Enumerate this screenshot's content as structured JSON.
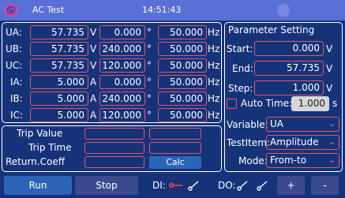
{
  "window": {
    "title": "AC Test",
    "time": "14:51:43"
  },
  "channels": [
    {
      "label": "UA:",
      "magnitude": "57.735",
      "mag_unit": "V",
      "angle": "0.000",
      "freq": "50.000"
    },
    {
      "label": "UB:",
      "magnitude": "57.735",
      "mag_unit": "V",
      "angle": "240.000",
      "freq": "50.000"
    },
    {
      "label": "UC:",
      "magnitude": "57.735",
      "mag_unit": "V",
      "angle": "120.000",
      "freq": "50.000"
    },
    {
      "label": "IA:",
      "magnitude": "5.000",
      "mag_unit": "A",
      "angle": "0.000",
      "freq": "50.000"
    },
    {
      "label": "IB:",
      "magnitude": "5.000",
      "mag_unit": "A",
      "angle": "240.000",
      "freq": "50.000"
    },
    {
      "label": "IC:",
      "magnitude": "5.000",
      "mag_unit": "A",
      "angle": "120.000",
      "freq": "50.000"
    }
  ],
  "units": {
    "angle": "°",
    "freq": "Hz"
  },
  "results": {
    "trip_value_label": "Trip Value",
    "trip_time_label": "Trip Time",
    "return_coeff_label": "Return.Coeff",
    "calc_label": "Calc"
  },
  "parameter": {
    "title": "Parameter Setting",
    "start_label": "Start:",
    "start_value": "0.000",
    "end_label": "End:",
    "end_value": "57.735",
    "step_label": "Step:",
    "step_value": "1.000",
    "unit": "V",
    "auto_time_label": "Auto Time:",
    "auto_time_value": "1.000",
    "auto_time_unit": "s",
    "auto_time_checked": false,
    "variable_label": "Variable:",
    "variable_value": "UA",
    "testitem_label": "TestItem:",
    "testitem_value": "Amplitude",
    "mode_label": "Mode:",
    "mode_value": "From-to"
  },
  "bottom": {
    "run_label": "Run",
    "stop_label": "Stop",
    "di_label": "DI:",
    "do_label": "DO:",
    "plus_label": "+",
    "minus_label": "-"
  },
  "icons": {
    "dropdown": "chevron-down-icon",
    "di_closed": "switch-closed-icon",
    "di_open": "switch-open-icon"
  },
  "colors": {
    "titlebar": "#5a6fd6",
    "background": "#16337a",
    "field_border": "#e0586b",
    "run_button": "#2c63b6",
    "calc_button": "#2a66b8"
  }
}
